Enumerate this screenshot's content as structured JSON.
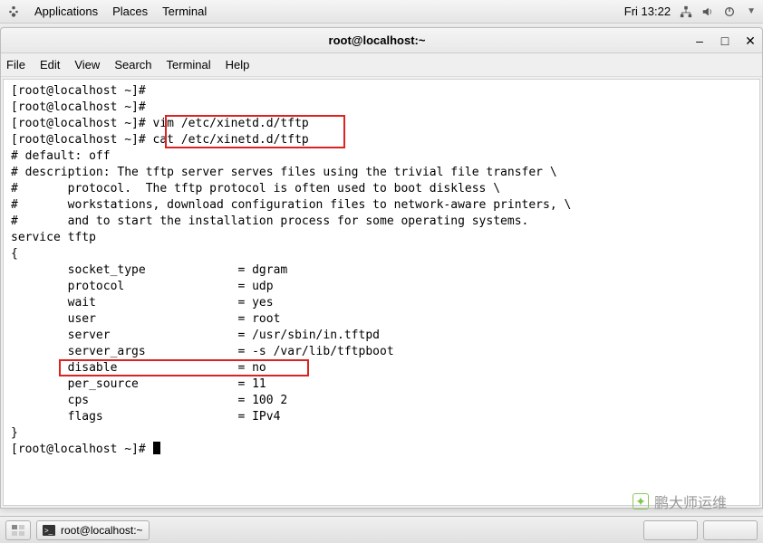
{
  "topbar": {
    "menus": [
      "Applications",
      "Places",
      "Terminal"
    ],
    "clock": "Fri 13:22"
  },
  "window": {
    "title": "root@localhost:~"
  },
  "menubar": {
    "items": [
      "File",
      "Edit",
      "View",
      "Search",
      "Terminal",
      "Help"
    ]
  },
  "terminal": {
    "prompt": "[root@localhost ~]#",
    "lines": [
      "[root@localhost ~]#",
      "[root@localhost ~]#",
      "[root@localhost ~]# vim /etc/xinetd.d/tftp",
      "[root@localhost ~]# cat /etc/xinetd.d/tftp",
      "# default: off",
      "# description: The tftp server serves files using the trivial file transfer \\",
      "#       protocol.  The tftp protocol is often used to boot diskless \\",
      "#       workstations, download configuration files to network-aware printers, \\",
      "#       and to start the installation process for some operating systems.",
      "service tftp",
      "{",
      "        socket_type             = dgram",
      "        protocol                = udp",
      "        wait                    = yes",
      "        user                    = root",
      "        server                  = /usr/sbin/in.tftpd",
      "        server_args             = -s /var/lib/tftpboot",
      "        disable                 = no",
      "        per_source              = 11",
      "        cps                     = 100 2",
      "        flags                   = IPv4",
      "}",
      "[root@localhost ~]# "
    ]
  },
  "taskbar": {
    "active_task": "root@localhost:~"
  },
  "watermark": "鹏大师运维"
}
